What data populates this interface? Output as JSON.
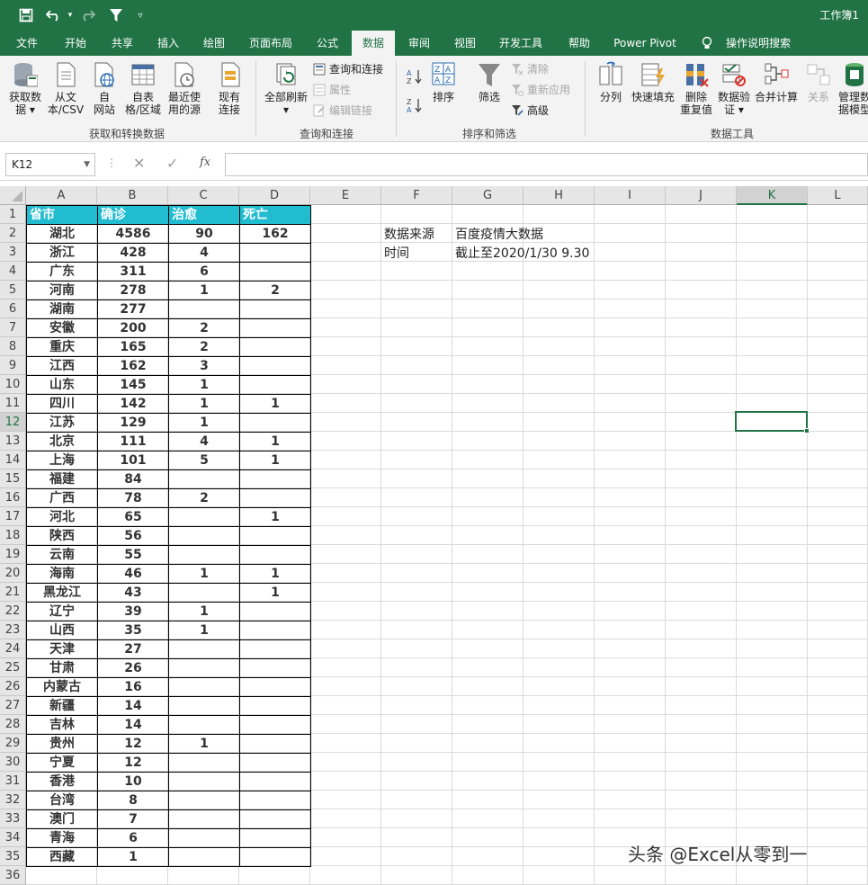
{
  "window": {
    "title": "工作簿1"
  },
  "quick_access": {
    "save": "save-icon",
    "undo": "undo-icon",
    "redo": "redo-icon",
    "filter": "filter-icon",
    "customize": "customize-icon"
  },
  "tabs": [
    "文件",
    "开始",
    "共享",
    "插入",
    "绘图",
    "页面布局",
    "公式",
    "数据",
    "审阅",
    "视图",
    "开发工具",
    "帮助",
    "Power Pivot",
    "操作说明搜索"
  ],
  "active_tab": "数据",
  "ribbon": {
    "get_data": {
      "btn1": "获取数",
      "btn1b": "据 ▾",
      "btn2": "从文",
      "btn2b": "本/CSV",
      "btn3": "自",
      "btn3b": "网站",
      "btn4": "自表",
      "btn4b": "格/区域",
      "btn5": "最近使",
      "btn5b": "用的源",
      "btn6": "现有",
      "btn6b": "连接",
      "group": "获取和转换数据"
    },
    "query": {
      "refresh": "全部刷新",
      "refresh_b": "▾",
      "queries": "查询和连接",
      "properties": "属性",
      "edit_links": "编辑链接",
      "group": "查询和连接"
    },
    "sort": {
      "sort": "排序",
      "filter": "筛选",
      "clear": "清除",
      "reapply": "重新应用",
      "advanced": "高级",
      "group": "排序和筛选"
    },
    "tools": {
      "split": "分列",
      "flash": "快速填充",
      "dup": "删除",
      "dup_b": "重复值",
      "valid": "数据验",
      "valid_b": "证 ▾",
      "consol": "合并计算",
      "rel": "关系",
      "model": "管理数",
      "model_b": "据模型",
      "group": "数据工具"
    }
  },
  "formula_bar": {
    "name_box": "K12",
    "fx": "fx"
  },
  "columns": [
    "A",
    "B",
    "C",
    "D",
    "E",
    "F",
    "G",
    "H",
    "I",
    "J",
    "K",
    "L"
  ],
  "selected_column": "K",
  "selected_row": "12",
  "table": {
    "headers": [
      "省市",
      "确诊",
      "治愈",
      "死亡"
    ],
    "rows": [
      [
        "湖北",
        "4586",
        "90",
        "162"
      ],
      [
        "浙江",
        "428",
        "4",
        ""
      ],
      [
        "广东",
        "311",
        "6",
        ""
      ],
      [
        "河南",
        "278",
        "1",
        "2"
      ],
      [
        "湖南",
        "277",
        "",
        ""
      ],
      [
        "安徽",
        "200",
        "2",
        ""
      ],
      [
        "重庆",
        "165",
        "2",
        ""
      ],
      [
        "江西",
        "162",
        "3",
        ""
      ],
      [
        "山东",
        "145",
        "1",
        ""
      ],
      [
        "四川",
        "142",
        "1",
        "1"
      ],
      [
        "江苏",
        "129",
        "1",
        ""
      ],
      [
        "北京",
        "111",
        "4",
        "1"
      ],
      [
        "上海",
        "101",
        "5",
        "1"
      ],
      [
        "福建",
        "84",
        "",
        ""
      ],
      [
        "广西",
        "78",
        "2",
        ""
      ],
      [
        "河北",
        "65",
        "",
        "1"
      ],
      [
        "陕西",
        "56",
        "",
        ""
      ],
      [
        "云南",
        "55",
        "",
        ""
      ],
      [
        "海南",
        "46",
        "1",
        "1"
      ],
      [
        "黑龙江",
        "43",
        "",
        "1"
      ],
      [
        "辽宁",
        "39",
        "1",
        ""
      ],
      [
        "山西",
        "35",
        "1",
        ""
      ],
      [
        "天津",
        "27",
        "",
        ""
      ],
      [
        "甘肃",
        "26",
        "",
        ""
      ],
      [
        "内蒙古",
        "16",
        "",
        ""
      ],
      [
        "新疆",
        "14",
        "",
        ""
      ],
      [
        "吉林",
        "14",
        "",
        ""
      ],
      [
        "贵州",
        "12",
        "1",
        ""
      ],
      [
        "宁夏",
        "12",
        "",
        ""
      ],
      [
        "香港",
        "10",
        "",
        ""
      ],
      [
        "台湾",
        "8",
        "",
        ""
      ],
      [
        "澳门",
        "7",
        "",
        ""
      ],
      [
        "青海",
        "6",
        "",
        ""
      ],
      [
        "西藏",
        "1",
        "",
        ""
      ]
    ]
  },
  "info": {
    "source_label": "数据来源",
    "source_value": "百度疫情大数据",
    "time_label": "时间",
    "time_value": "截止至2020/1/30  9.30"
  },
  "watermark": "头条 @Excel从零到一"
}
